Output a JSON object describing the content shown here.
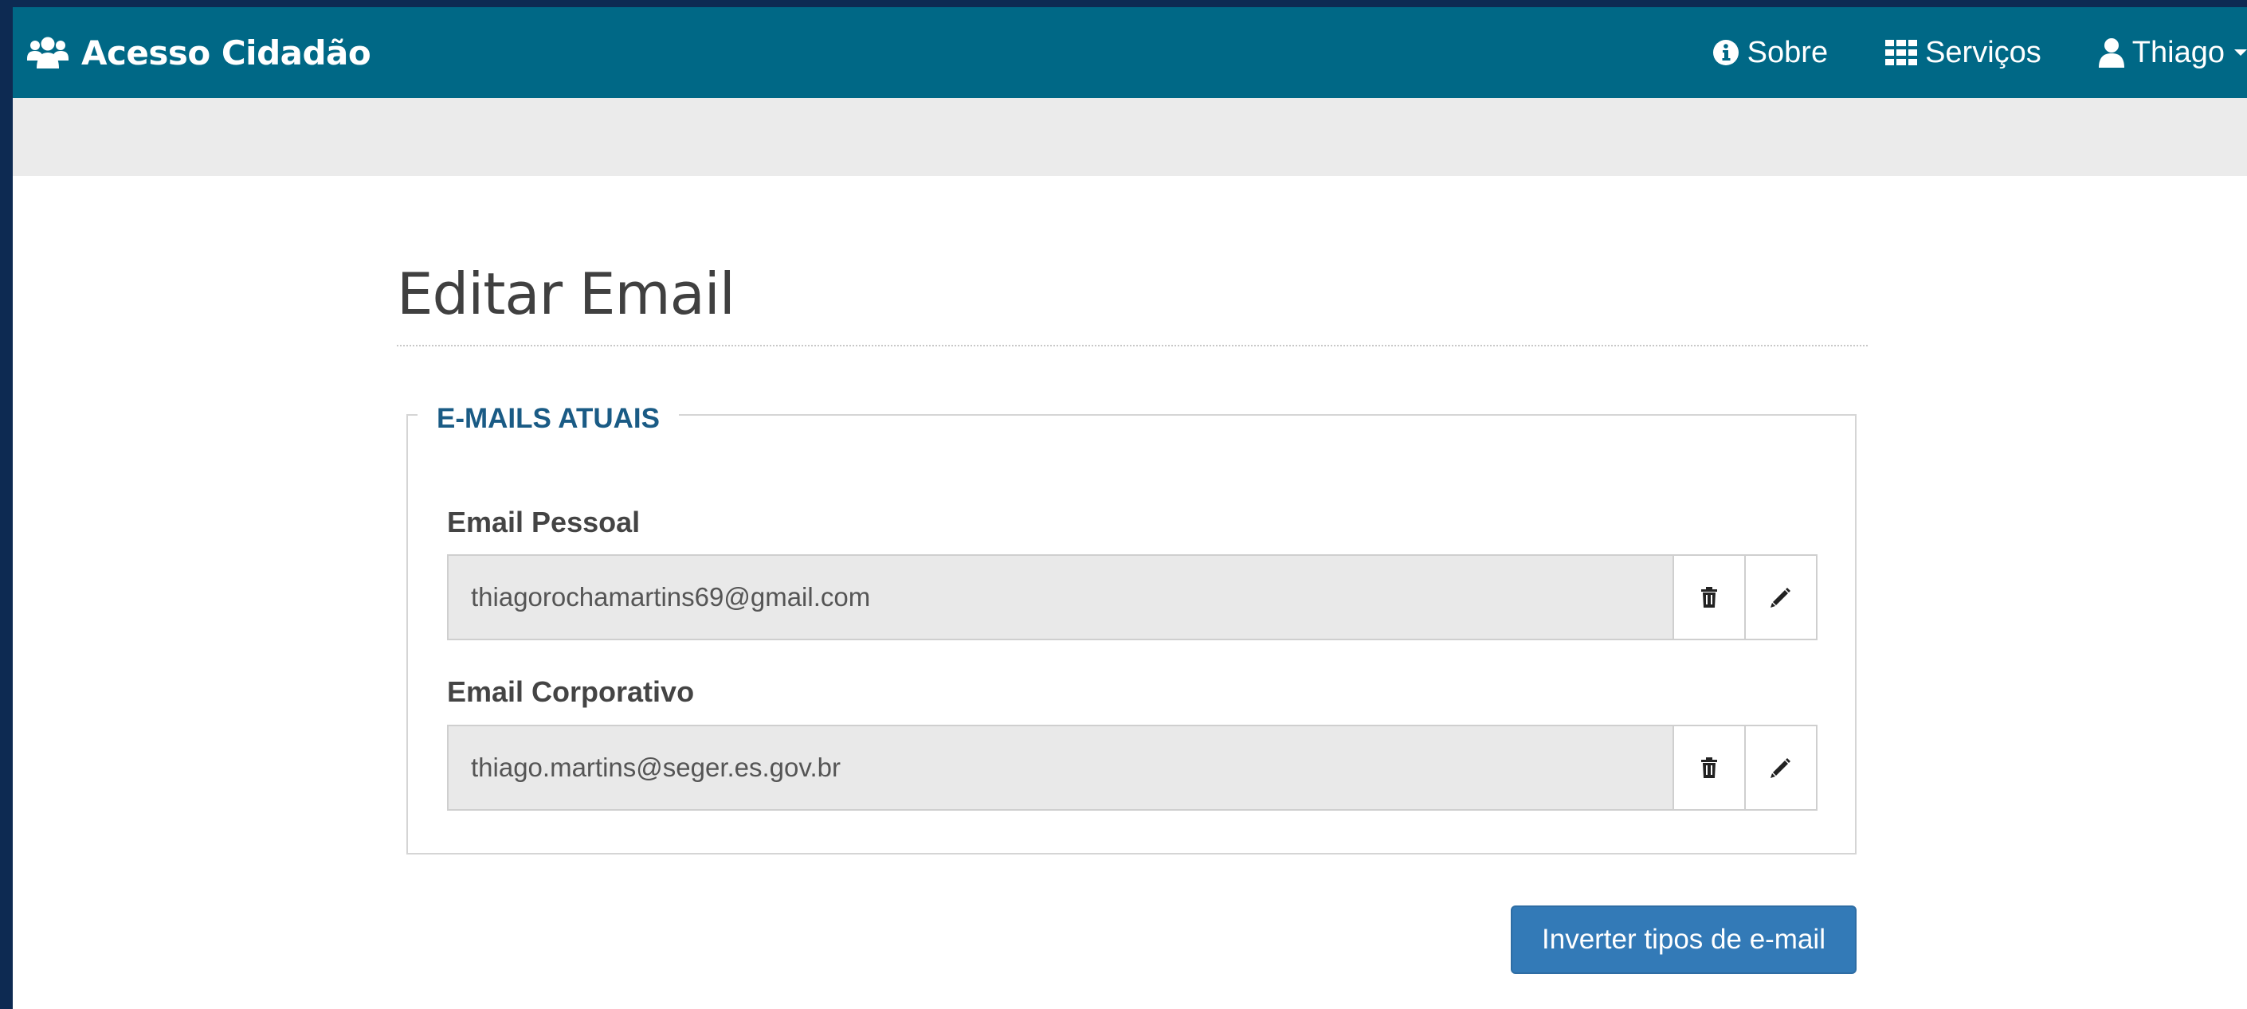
{
  "navbar": {
    "brand": "Acesso Cidadão",
    "brand_icon": "users-icon",
    "items": [
      {
        "label": "Sobre",
        "icon": "info-circle-icon"
      },
      {
        "label": "Serviços",
        "icon": "th-grid-icon"
      },
      {
        "label": "Thiago",
        "icon": "user-icon"
      }
    ]
  },
  "page": {
    "title": "Editar Email"
  },
  "emails_section": {
    "legend": "E-MAILS ATUAIS",
    "fields": [
      {
        "label": "Email Pessoal",
        "value": "thiagorochamartins69@gmail.com"
      },
      {
        "label": "Email Corporativo",
        "value": "thiago.martins@seger.es.gov.br"
      }
    ],
    "delete_icon": "trash-icon",
    "edit_icon": "pencil-icon"
  },
  "actions": {
    "swap_label": "Inverter tipos de e-mail"
  },
  "colors": {
    "navbar": "#006886",
    "primary": "#337ab7",
    "legend": "#1a5b85"
  }
}
